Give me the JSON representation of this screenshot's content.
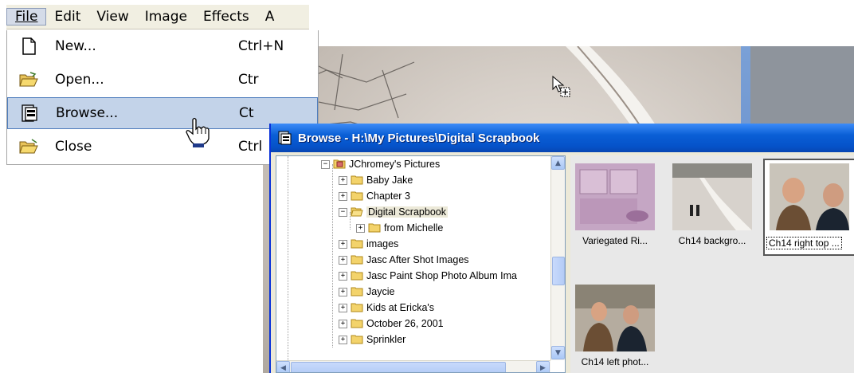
{
  "menubar": {
    "items": [
      {
        "label": "File",
        "mnemonic": "F"
      },
      {
        "label": "Edit",
        "mnemonic": "E"
      },
      {
        "label": "View",
        "mnemonic": "V"
      },
      {
        "label": "Image",
        "mnemonic": "I"
      },
      {
        "label": "Effects",
        "mnemonic": "t"
      },
      {
        "label": "A"
      }
    ]
  },
  "file_menu": {
    "items": [
      {
        "label": "New...",
        "shortcut": "Ctrl+N",
        "icon": "new-document-icon"
      },
      {
        "label": "Open...",
        "shortcut": "Ctr",
        "icon": "open-folder-icon"
      },
      {
        "label": "Browse...",
        "shortcut": "Ct",
        "icon": "browse-icon",
        "selected": true
      },
      {
        "label": "Close",
        "shortcut": "Ctrl",
        "icon": "close-folder-icon"
      }
    ]
  },
  "browse_window": {
    "title": "Browse - H:\\My Pictures\\Digital Scrapbook",
    "tree": [
      {
        "label": "JChromey's Pictures",
        "level": 0,
        "expanded": true
      },
      {
        "label": "Baby Jake",
        "level": 1
      },
      {
        "label": "Chapter 3",
        "level": 1
      },
      {
        "label": "Digital Scrapbook",
        "level": 1,
        "expanded": true,
        "selected": true
      },
      {
        "label": "from Michelle",
        "level": 2
      },
      {
        "label": "images",
        "level": 1
      },
      {
        "label": "Jasc After Shot Images",
        "level": 1
      },
      {
        "label": "Jasc Paint Shop Photo Album Ima",
        "level": 1
      },
      {
        "label": "Jaycie",
        "level": 1
      },
      {
        "label": "Kids at Ericka's",
        "level": 1
      },
      {
        "label": "October 26, 2001",
        "level": 1
      },
      {
        "label": "Sprinkler",
        "level": 1
      }
    ],
    "thumbnails": [
      {
        "caption": "Variegated Ri...",
        "kind": "scrapbook"
      },
      {
        "caption": "Ch14 backgro...",
        "kind": "road"
      },
      {
        "caption": "Ch14 right top ...",
        "kind": "portrait",
        "selected": true
      },
      {
        "caption": "Ch14 left phot...",
        "kind": "two-men"
      }
    ]
  },
  "colors": {
    "titlebar": "#0552c9",
    "menu_highlight": "#c3d3e9",
    "menu_highlight_border": "#4f7dbd"
  }
}
